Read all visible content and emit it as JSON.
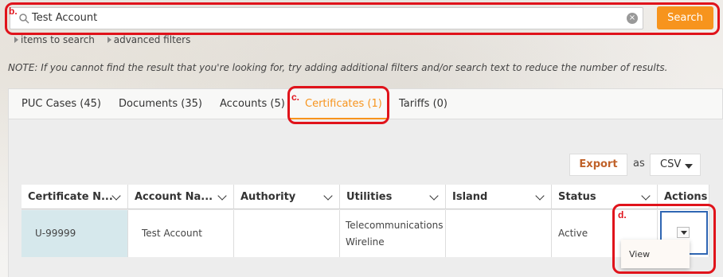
{
  "search": {
    "value": "Test Account",
    "button_label": "Search",
    "clear_symbol": "×",
    "options": [
      "items to search",
      "advanced filters"
    ]
  },
  "note": "NOTE: If you cannot find the result that you're looking for, try adding additional filters and/or search text to reduce the number of results.",
  "tabs": [
    {
      "label": "PUC Cases (45)",
      "active": false
    },
    {
      "label": "Documents (35)",
      "active": false
    },
    {
      "label": "Accounts (5)",
      "active": false
    },
    {
      "label": "Certificates (1)",
      "active": true
    },
    {
      "label": "Tariffs (0)",
      "active": false
    }
  ],
  "export": {
    "button_label": "Export",
    "as_label": "as",
    "format": "CSV"
  },
  "table": {
    "columns": [
      "Certificate N...",
      "Account Na...",
      "Authority",
      "Utilities",
      "Island",
      "Status",
      "Actions"
    ],
    "rows": [
      {
        "certificate": "U-99999",
        "account": "Test Account",
        "authority": "",
        "utilities_line1": "Telecommunications",
        "utilities_line2": "Wireline",
        "island": "",
        "status": "Active"
      }
    ]
  },
  "actions_menu": {
    "items": [
      "View"
    ]
  },
  "annotations": {
    "b": "b.",
    "c": "c.",
    "d": "d."
  },
  "colors": {
    "accent": "#f7941d",
    "annotation": "#e0131b",
    "selected_row": "#d6e8ec",
    "focus": "#2f66b3"
  }
}
